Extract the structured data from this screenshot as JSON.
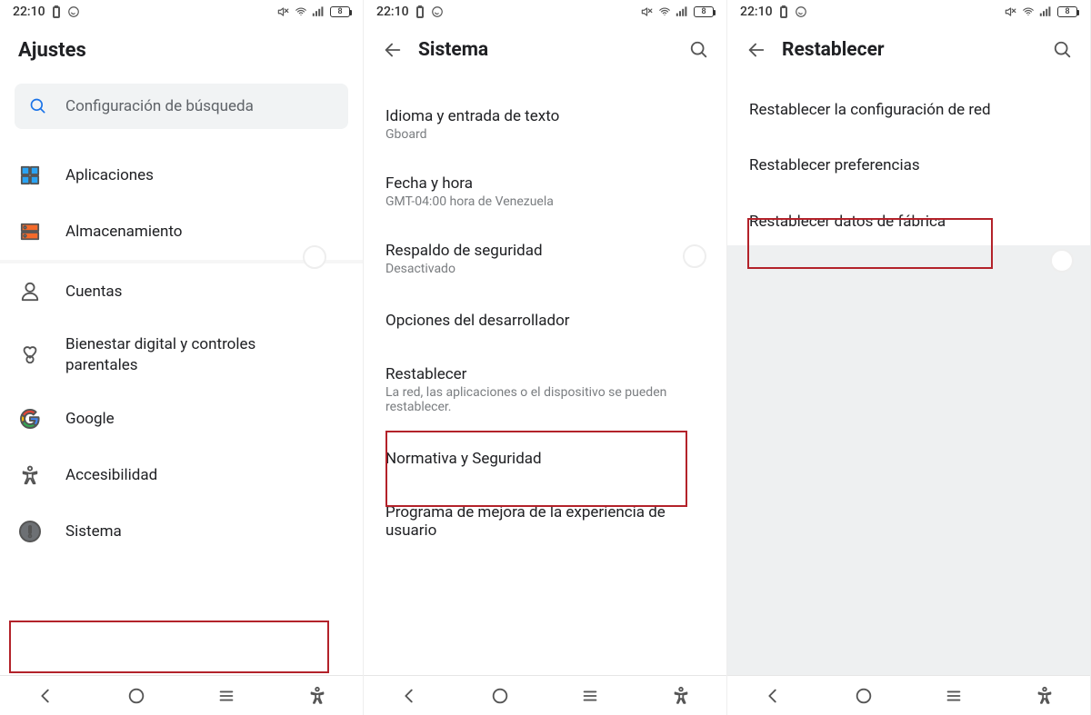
{
  "status": {
    "time": "22:10",
    "battery_pct": "8"
  },
  "panel1": {
    "title": "Ajustes",
    "search_placeholder": "Configuración de búsqueda",
    "items": [
      {
        "label": "Aplicaciones"
      },
      {
        "label": "Almacenamiento"
      },
      {
        "label": "Cuentas"
      },
      {
        "label": "Bienestar digital y controles parentales"
      },
      {
        "label": "Google"
      },
      {
        "label": "Accesibilidad"
      },
      {
        "label": "Sistema"
      }
    ]
  },
  "panel2": {
    "title": "Sistema",
    "items": [
      {
        "label": "Idioma y entrada de texto",
        "sub": "Gboard"
      },
      {
        "label": "Fecha y hora",
        "sub": "GMT-04:00 hora de Venezuela"
      },
      {
        "label": "Respaldo de seguridad",
        "sub": "Desactivado"
      },
      {
        "label": "Opciones del desarrollador"
      },
      {
        "label": "Restablecer",
        "sub": "La red, las aplicaciones o el dispositivo se pueden restablecer."
      },
      {
        "label": "Normativa y Seguridad"
      },
      {
        "label": "Programa de mejora de la experiencia de usuario"
      }
    ]
  },
  "panel3": {
    "title": "Restablecer",
    "items": [
      {
        "label": "Restablecer la configuración de red"
      },
      {
        "label": "Restablecer preferencias"
      },
      {
        "label": "Restablecer datos de fábrica"
      }
    ]
  }
}
